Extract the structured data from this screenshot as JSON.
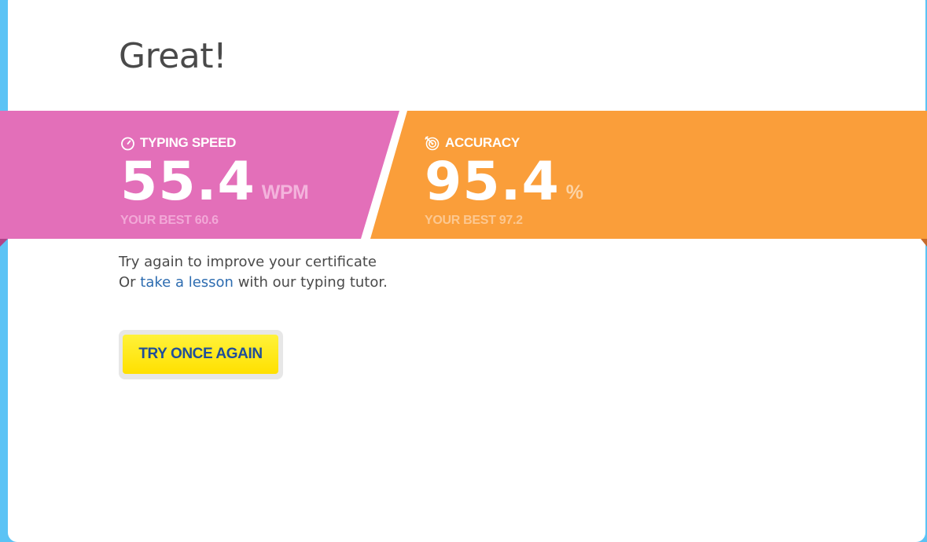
{
  "result": {
    "heading": "Great!"
  },
  "speed": {
    "label": "TYPING SPEED",
    "value": "55.4",
    "unit": "WPM",
    "best": "YOUR BEST 60.6",
    "icon": "stopwatch-icon",
    "color": "#e36fb9"
  },
  "accuracy": {
    "label": "ACCURACY",
    "value": "95.4",
    "unit": "%",
    "best": "YOUR BEST 97.2",
    "icon": "target-icon",
    "color": "#fa9e3a"
  },
  "message": {
    "line1": "Try again to improve your certificate",
    "line2_prefix": "Or ",
    "lesson_link": "take a lesson",
    "line2_suffix": " with our typing tutor."
  },
  "actions": {
    "retry_label": "TRY ONCE AGAIN",
    "retry_color": "#ffe81a"
  }
}
